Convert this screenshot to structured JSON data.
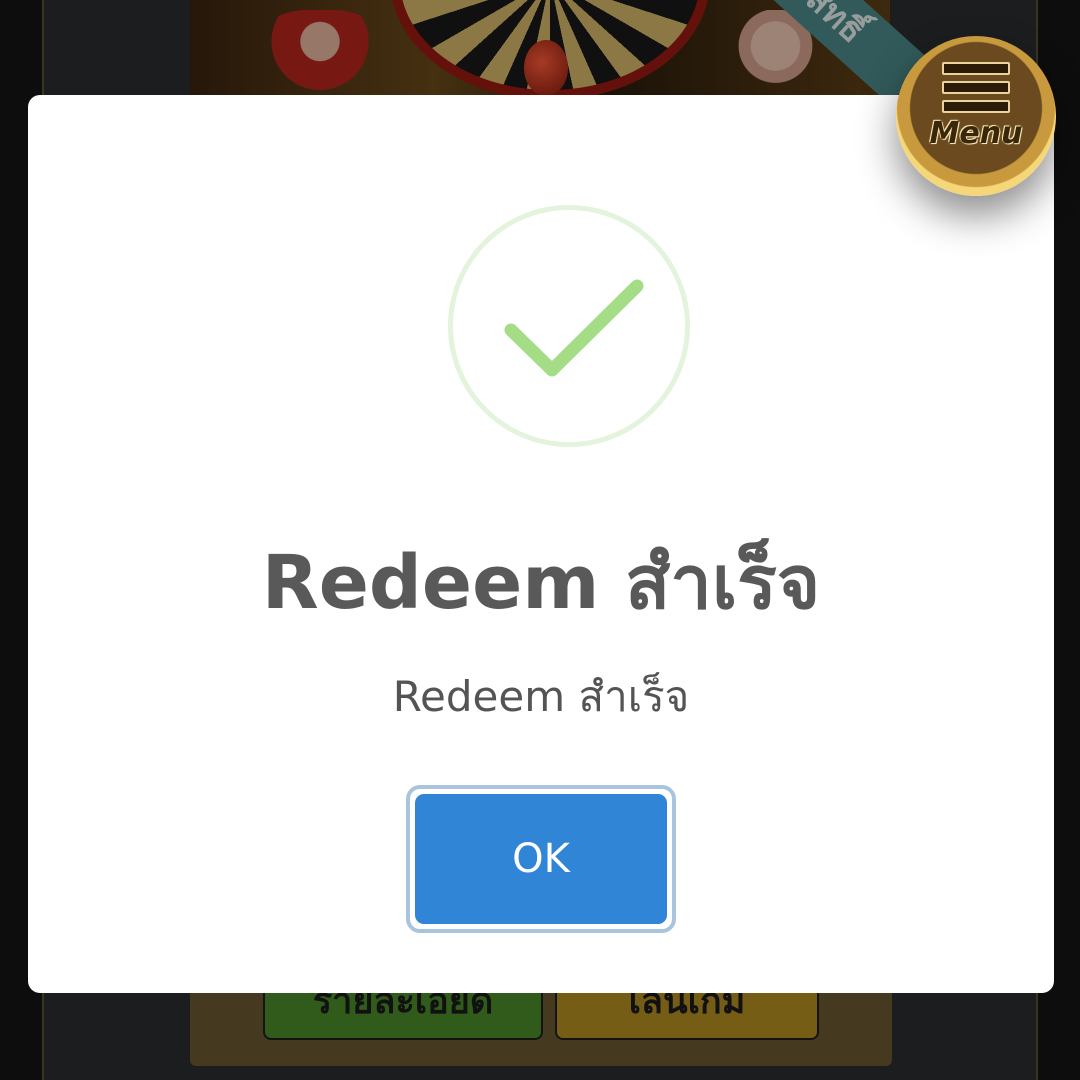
{
  "background": {
    "banner_ribbon_text": "สิทธิ์",
    "bottom_buttons": {
      "details_label": "รายละเอียด",
      "play_label": "เล่นเกม"
    }
  },
  "dialog": {
    "icon": "success-check-icon",
    "title": "Redeem สำเร็จ",
    "message": "Redeem สำเร็จ",
    "ok_label": "OK"
  },
  "menu": {
    "icon": "hamburger-icon",
    "label": "Menu"
  },
  "colors": {
    "confirm_button": "#3085d6",
    "success_icon": "#a5dc86",
    "success_ring": "#e4f3dc",
    "title_text": "#595959"
  }
}
